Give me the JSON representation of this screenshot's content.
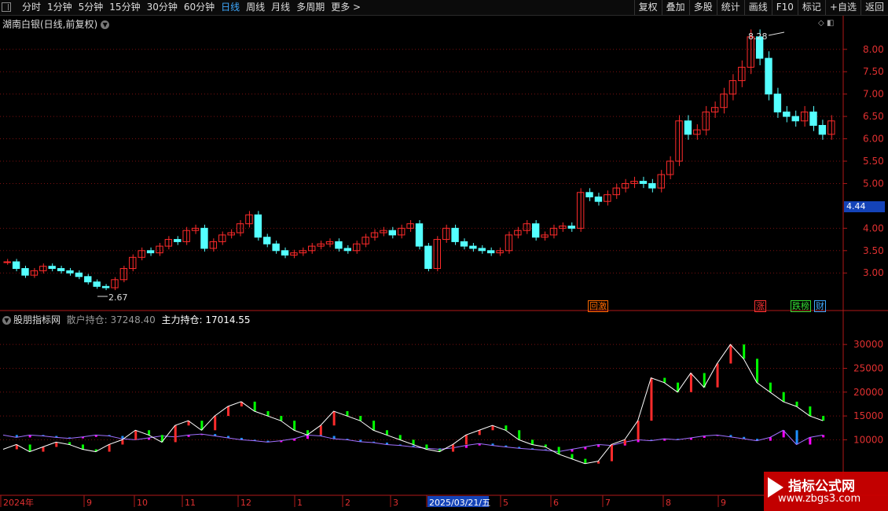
{
  "toolbar": {
    "tabs": [
      "分时",
      "1分钟",
      "5分钟",
      "15分钟",
      "30分钟",
      "60分钟",
      "日线",
      "周线",
      "月线",
      "多周期",
      "更多 >"
    ],
    "active_tab": "日线",
    "right_buttons": [
      "复权",
      "叠加",
      "多股",
      "统计",
      "画线",
      "F10",
      "标记",
      "+自选",
      "返回"
    ]
  },
  "chart_header": {
    "title": "湖南白银(日线,前复权)"
  },
  "price_axis": {
    "ticks": [
      "8.00",
      "7.50",
      "7.00",
      "6.50",
      "6.00",
      "5.50",
      "5.00",
      "4.44",
      "4.00",
      "3.50",
      "3.00"
    ],
    "current": "4.44"
  },
  "annotations": {
    "high": "8.28",
    "low": "2.67"
  },
  "badges": [
    {
      "text": "回激",
      "color": "#ff6a00"
    },
    {
      "text": "涨",
      "color": "#ff3333"
    },
    {
      "text": "跌榜",
      "color": "#33dd33"
    },
    {
      "text": "财",
      "color": "#3fa9ff"
    }
  ],
  "indicator": {
    "name": "股朋指标网",
    "retail_label": "散户持仓:",
    "retail_value": "37248.40",
    "main_label": "主力持仓:",
    "main_value": "17014.55",
    "axis_ticks": [
      "30000",
      "25000",
      "20000",
      "15000",
      "10000"
    ]
  },
  "date_axis": {
    "labels": [
      "2024年",
      "9",
      "10",
      "11",
      "12",
      "1",
      "2",
      "3",
      "2025/03/21/五",
      "5",
      "6",
      "7",
      "8",
      "9"
    ]
  },
  "watermark": {
    "line1": "指标公式网",
    "line2": "www.zbgs3.com"
  },
  "colors": {
    "up": "#ff2b2b",
    "down": "#54ffff",
    "retail": "#ffffff",
    "main_up": "#ff00ff",
    "main_down": "#1e90ff",
    "green": "#00ff00",
    "grid": "#7a1010"
  },
  "chart_data": {
    "type": "candlestick",
    "title": "湖南白银(日线,前复权)",
    "ylim": [
      2.6,
      8.4
    ],
    "close_series_approx": [
      3.25,
      3.1,
      2.95,
      3.05,
      3.15,
      3.1,
      3.05,
      3.0,
      2.92,
      2.8,
      2.7,
      2.67,
      2.85,
      3.1,
      3.35,
      3.5,
      3.45,
      3.6,
      3.75,
      3.7,
      3.95,
      4.0,
      3.55,
      3.7,
      3.85,
      3.9,
      4.1,
      4.3,
      3.8,
      3.65,
      3.5,
      3.4,
      3.45,
      3.5,
      3.6,
      3.65,
      3.7,
      3.55,
      3.5,
      3.65,
      3.8,
      3.9,
      3.95,
      3.85,
      4.0,
      4.1,
      3.6,
      3.1,
      3.75,
      4.0,
      3.7,
      3.6,
      3.55,
      3.5,
      3.45,
      3.5,
      3.85,
      3.95,
      4.1,
      3.8,
      3.85,
      4.0,
      4.05,
      4.0,
      4.8,
      4.7,
      4.6,
      4.75,
      4.9,
      5.0,
      5.05,
      5.0,
      4.9,
      5.2,
      5.5,
      6.4,
      6.1,
      6.2,
      6.6,
      6.7,
      7.0,
      7.3,
      7.6,
      8.28,
      7.8,
      7.0,
      6.6,
      6.5,
      6.4,
      6.6,
      6.3,
      6.1,
      6.4
    ],
    "retail_series_approx": [
      8000,
      9000,
      7500,
      8500,
      9500,
      9000,
      8000,
      7500,
      9000,
      10000,
      12000,
      11000,
      9500,
      13000,
      14000,
      12000,
      15000,
      17000,
      18000,
      16000,
      15000,
      14000,
      12000,
      11000,
      13000,
      16000,
      15000,
      14000,
      12000,
      11000,
      10000,
      9000,
      8000,
      7500,
      9000,
      11000,
      12000,
      13000,
      12000,
      10000,
      9000,
      8500,
      7000,
      6000,
      5000,
      5500,
      9000,
      10000,
      14000,
      23000,
      22000,
      20000,
      24000,
      21000,
      26000,
      30000,
      27000,
      22000,
      20000,
      18000,
      17000,
      15000,
      14000
    ],
    "main_series_approx": [
      11000,
      10500,
      11000,
      10800,
      10500,
      10300,
      10600,
      11000,
      10800,
      10200,
      10000,
      10400,
      10800,
      10600,
      11000,
      11200,
      10800,
      10400,
      10000,
      9800,
      9500,
      9800,
      10200,
      11000,
      10800,
      10200,
      10000,
      9600,
      9400,
      9000,
      8800,
      8500,
      8200,
      8000,
      8300,
      8800,
      9200,
      8800,
      8500,
      8200,
      8000,
      7800,
      7500,
      8000,
      8500,
      9000,
      8800,
      9500,
      10000,
      9800,
      10200,
      10000,
      10400,
      10800,
      11000,
      10600,
      10200,
      9800,
      10500,
      12000,
      9000,
      10500,
      11000
    ]
  }
}
